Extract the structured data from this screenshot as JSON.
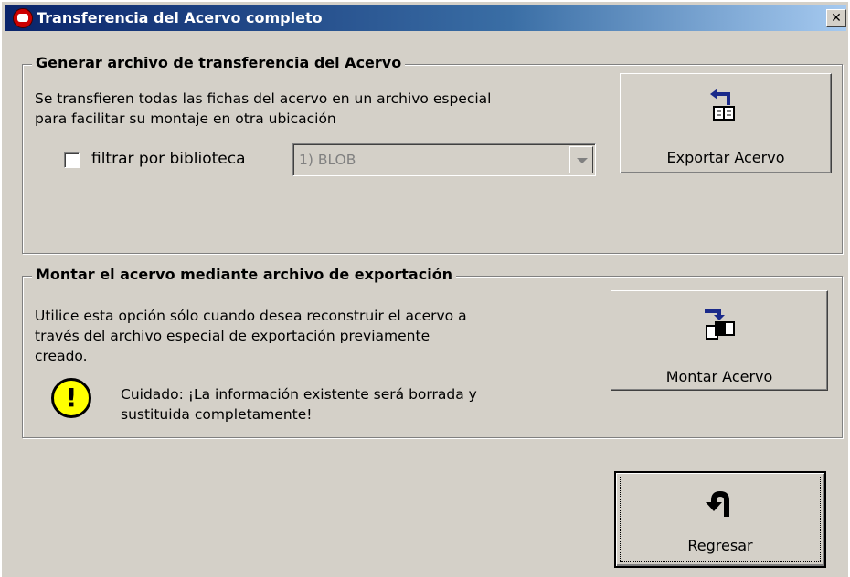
{
  "window": {
    "title": "Transferencia del Acervo completo",
    "close_glyph": "✕"
  },
  "export_group": {
    "legend": "Generar archivo de transferencia del Acervo",
    "description_line1": "Se transfieren todas las fichas del acervo en un archivo especial",
    "description_line2": "para facilitar su montaje en otra ubicación",
    "filter_label": "filtrar por biblioteca",
    "filter_checked": false,
    "library_selected": "1) BLOB",
    "export_button_label": "Exportar Acervo",
    "export_icon": "export-book-icon"
  },
  "mount_group": {
    "legend": "Montar el acervo mediante archivo de exportación",
    "description_line1": "Utilice esta opción sólo cuando desea reconstruir el acervo a",
    "description_line2": "través del archivo especial de exportación previamente",
    "description_line3": "creado.",
    "warning_line1": "Cuidado: ¡La información existente será borrada y",
    "warning_line2": "sustituida completamente!",
    "warning_glyph": "!",
    "mount_button_label": "Montar Acervo",
    "mount_icon": "import-pages-icon"
  },
  "footer": {
    "back_button_label": "Regresar",
    "back_icon": "u-turn-arrow-icon"
  },
  "colors": {
    "window_bg": "#d4d0c8",
    "title_bar": "#0a246a",
    "warning": "#ffff00",
    "arrow": "#1a2a8a"
  }
}
